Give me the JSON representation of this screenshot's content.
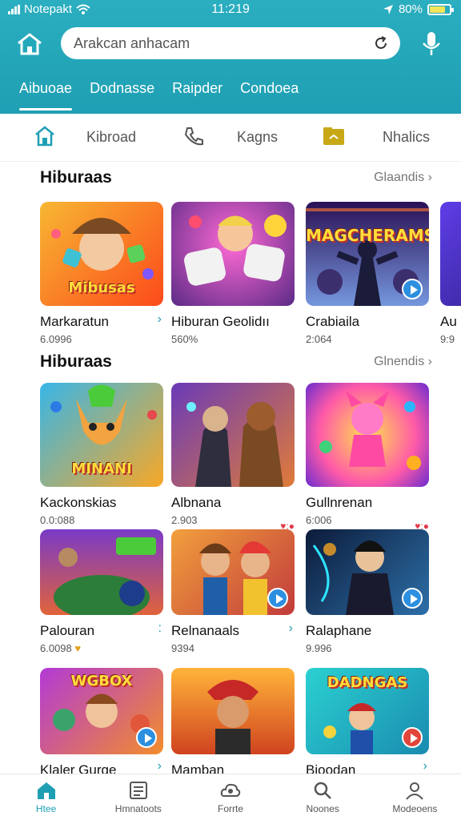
{
  "status_bar": {
    "carrier": "Notepakt",
    "time": "11:219",
    "battery": "80%",
    "battery_level": 0.8
  },
  "header": {
    "search_placeholder": "Arakcan anhacam"
  },
  "top_tabs": [
    {
      "label": "Aibuoae",
      "active": true
    },
    {
      "label": "Dodnasse"
    },
    {
      "label": "Raipder"
    },
    {
      "label": "Condoea"
    }
  ],
  "categories": [
    {
      "label": "",
      "icon": "home-icon",
      "color": "#1f9fb3"
    },
    {
      "label": "Kibroad",
      "icon": ""
    },
    {
      "label": "",
      "icon": "phone-icon",
      "color": "#555555"
    },
    {
      "label": "Kagns",
      "icon": ""
    },
    {
      "label": "",
      "icon": "folder-icon",
      "color": "#c9a818"
    },
    {
      "label": "Nhalics",
      "icon": ""
    }
  ],
  "sections": [
    {
      "title": "Hiburaas",
      "more": "Glaandis",
      "cards": [
        {
          "name": "Markaratun",
          "sub": "6.0996",
          "thumb_title": "Mibusas",
          "arrow": "›"
        },
        {
          "name": "Hiburan Geolidıı",
          "sub": "560%"
        },
        {
          "name": "Crabiaila",
          "sub": "2:064",
          "thumb_title": "MAGCHERAMS"
        },
        {
          "name": "Au",
          "sub": "9:9"
        }
      ]
    },
    {
      "title": "Hiburaas",
      "more": "Glnendis",
      "cards": [
        {
          "name": "Kackonskias",
          "sub": "0.0:088",
          "thumb_title": "MINANI"
        },
        {
          "name": "Albnana",
          "sub": "2.903",
          "likes": "♥:●"
        },
        {
          "name": "Gullnrenan",
          "sub": "6:006",
          "likes": "♥:●"
        },
        {
          "name": "Palouran",
          "sub": "6.0098",
          "extra": "♥",
          "arrow": ":"
        },
        {
          "name": "Relnanaals",
          "sub": "9394",
          "arrow": "›"
        },
        {
          "name": "Ralaphane",
          "sub": "9.996"
        },
        {
          "name": "Klaler Gurge",
          "sub": "",
          "thumb_title": "WGBOX",
          "arrow": "›"
        },
        {
          "name": "Mamban",
          "sub": ""
        },
        {
          "name": "Bioodan",
          "sub": "",
          "thumb_title": "DADNGAS",
          "arrow": "›"
        }
      ]
    }
  ],
  "bottom_nav": [
    {
      "label": "Htee",
      "icon": "home-icon",
      "active": true
    },
    {
      "label": "Hmnatoots",
      "icon": "list-icon"
    },
    {
      "label": "Forrte",
      "icon": "cloud-icon"
    },
    {
      "label": "Noones",
      "icon": "search-icon"
    },
    {
      "label": "Modeoens",
      "icon": "profile-icon"
    }
  ]
}
